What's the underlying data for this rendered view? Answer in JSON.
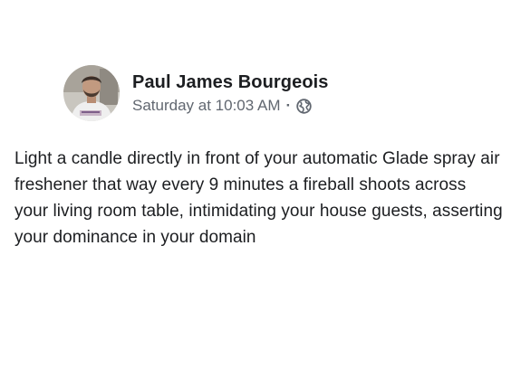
{
  "post": {
    "author": "Paul James Bourgeois",
    "timestamp": "Saturday at 10:03 AM",
    "separator": "·",
    "privacy_icon": "globe-icon",
    "avatar_icon": "profile-photo",
    "message": "Light a candle directly in front of your automatic Glade spray air freshener that way every 9 minutes a fireball shoots across your living room table, intimidating your house guests, asserting your dominance in your domain"
  },
  "colors": {
    "text_primary": "#1c1e21",
    "text_secondary": "#616770",
    "background": "#ffffff"
  }
}
